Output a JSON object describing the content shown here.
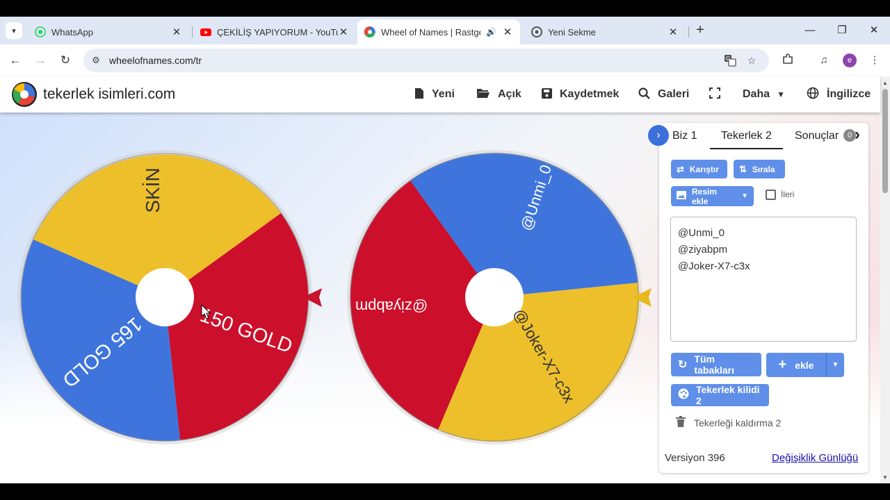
{
  "browser": {
    "tabs": [
      {
        "title": "WhatsApp",
        "icon": "whatsapp-icon",
        "active": false
      },
      {
        "title": "ÇEKİLİŞ YAPIYORUM - YouTube",
        "icon": "youtube-icon",
        "active": false
      },
      {
        "title": "Wheel of Names | Rastgele",
        "icon": "wheelofnames-icon",
        "active": true,
        "audio": true
      },
      {
        "title": "Yeni Sekme",
        "icon": "chrome-icon",
        "active": false
      }
    ],
    "url": "wheelofnames.com/tr"
  },
  "site": {
    "brand": "tekerlek isimleri.com",
    "menu": [
      {
        "label": "Yeni",
        "icon": "file-icon"
      },
      {
        "label": "Açık",
        "icon": "folder-open-icon"
      },
      {
        "label": "Kaydetmek",
        "icon": "save-icon"
      },
      {
        "label": "Galeri",
        "icon": "search-icon"
      },
      {
        "label": "",
        "icon": "fullscreen-icon"
      },
      {
        "label": "Daha",
        "icon": "caret-down-icon"
      },
      {
        "label": "İngilizce",
        "icon": "globe-icon"
      }
    ]
  },
  "wheels": [
    {
      "name": "wheel-1",
      "segments": [
        {
          "label": "SKİN",
          "color": "#edbf2b"
        },
        {
          "label": "150 GOLD",
          "color": "#cc0f2b"
        },
        {
          "label": "165 GOLD",
          "color": "#3e74dc"
        }
      ],
      "pointer_color": "#c8142f"
    },
    {
      "name": "wheel-2",
      "segments": [
        {
          "label": "@Unmi_0",
          "color": "#3e74dc"
        },
        {
          "label": "@Joker-X7-c3x",
          "color": "#edbf2b"
        },
        {
          "label": "@ziyabpm",
          "color": "#cc0f2b"
        }
      ],
      "pointer_color": "#e8b81f"
    }
  ],
  "panel": {
    "tabs": [
      "Biz 1",
      "Tekerlek 2",
      "Sonuçlar"
    ],
    "results_count": "0",
    "shuffle_label": "Karıştır",
    "sort_label": "Sırala",
    "add_image_label": "Resim ekle",
    "advanced_label": "İleri",
    "entries": [
      "@Unmi_0",
      "@ziyabpm",
      "@Joker-X7-c3x"
    ],
    "all_sheets_label": "Tüm tabakları",
    "add_label": "ekle",
    "wheel_lock_label": "Tekerlek kilidi 2",
    "remove_wheel_label": "Tekerleği kaldırma 2",
    "version_label": "Versiyon 396",
    "changelog_label": "Değişiklik Günlüğü"
  },
  "colors": {
    "accent": "#5f8fe8",
    "red": "#cc0f2b",
    "yellow": "#edbf2b",
    "blue": "#3e74dc"
  }
}
